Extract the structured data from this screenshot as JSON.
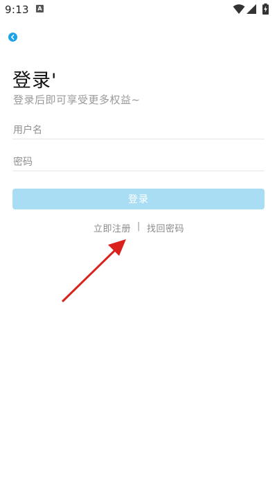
{
  "status_bar": {
    "time": "9:13",
    "notification_glyph": "A",
    "icons": [
      "wifi-icon",
      "signal-icon",
      "battery-charging-icon"
    ]
  },
  "header": {
    "back_icon": "chevron-left-icon"
  },
  "title": "登录'",
  "subtitle": "登录后即可享受更多权益~",
  "form": {
    "username_placeholder": "用户名",
    "password_placeholder": "密码",
    "login_label": "登录"
  },
  "links": {
    "register": "立即注册",
    "divider": "|",
    "reset_password": "找回密码"
  },
  "colors": {
    "accent": "#1aa3e8",
    "login_button_disabled": "#a9ddf4",
    "annotation_arrow": "#d9221c"
  }
}
